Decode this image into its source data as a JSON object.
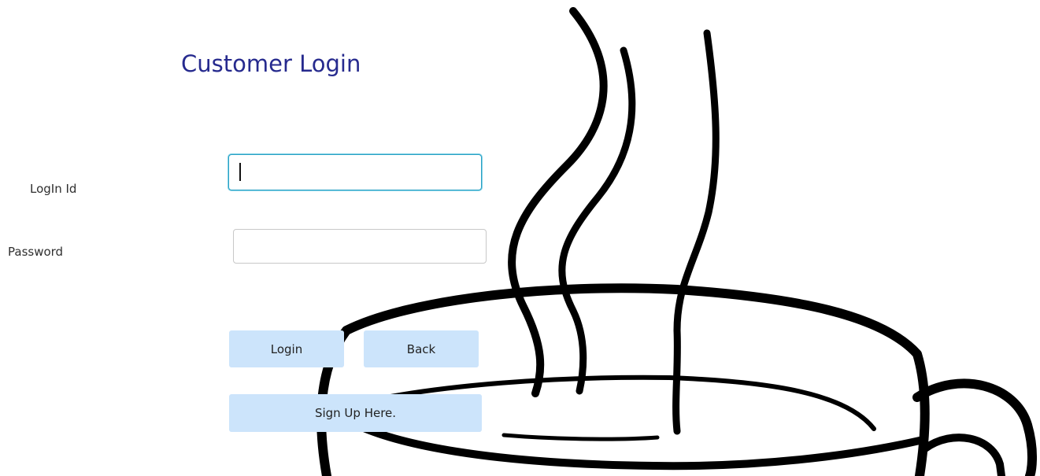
{
  "header": {
    "title": "Customer Login"
  },
  "form": {
    "login_id_label": "LogIn Id",
    "login_id_value": "",
    "password_label": "Password",
    "password_value": ""
  },
  "buttons": {
    "login": "Login",
    "back": "Back",
    "signup": "Sign Up Here."
  },
  "colors": {
    "title": "#262a8e",
    "button_bg": "#cce4fb",
    "focus_border": "#2aa1c4",
    "art_stroke": "#000000"
  },
  "background": {
    "icon": "steaming-coffee-cup-icon"
  }
}
